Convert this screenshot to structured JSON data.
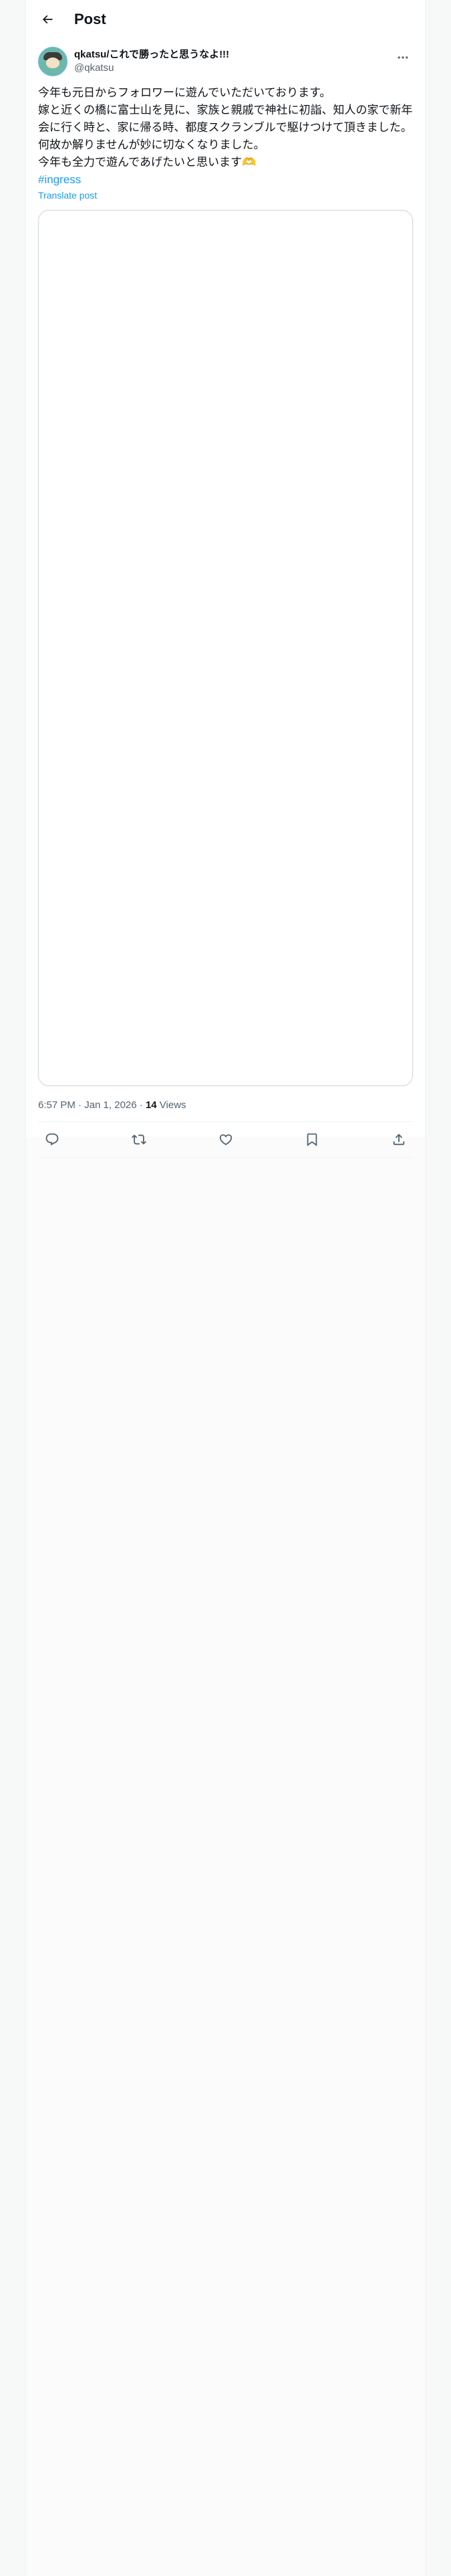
{
  "header": {
    "title": "Post"
  },
  "post": {
    "author": {
      "display_name": "qkatsu/これで勝ったと思うなよ!!!",
      "handle": "@qkatsu"
    },
    "text": "今年も元日からフォロワーに遊んでいただいております。\n嫁と近くの橋に富士山を見に、家族と親戚で神社に初詣、知人の家で新年会に行く時と、家に帰る時、都度スクランブルで駆けつけて頂きました。\n何故か解りませんが妙に切なくなりました。\n今年も全力で遊んであげたいと思います🫶",
    "hashtag": "#ingress",
    "translate_label": "Translate post",
    "timestamp": "6:57 PM · Jan 1, 2026",
    "separator": " · ",
    "views_count": "14",
    "views_label": " Views"
  },
  "icons": {
    "back": "back-arrow-icon",
    "more": "more-dots-icon",
    "reply": "reply-icon",
    "repost": "repost-icon",
    "like": "like-icon",
    "bookmark": "bookmark-icon",
    "share": "share-icon"
  },
  "colors": {
    "accent": "#1d9bf0",
    "text": "#0f1419",
    "secondary": "#536471",
    "border": "#eff3f4"
  }
}
